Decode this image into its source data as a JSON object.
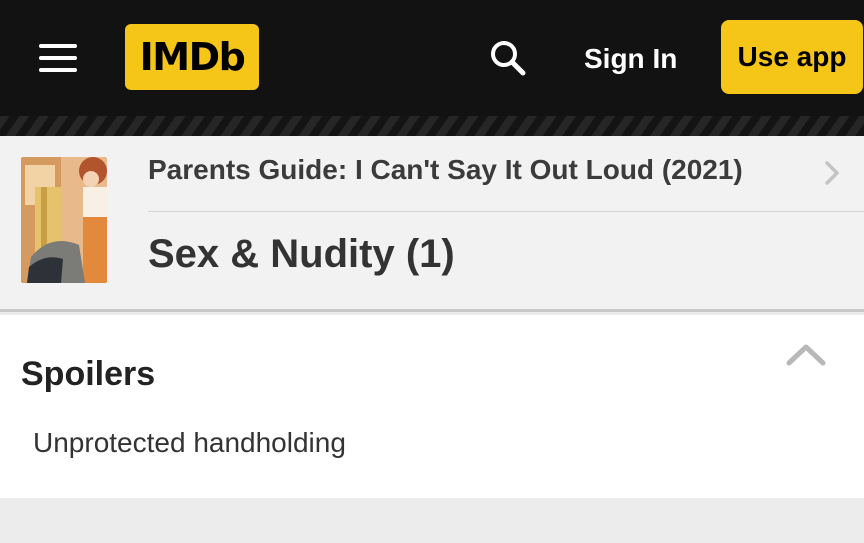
{
  "header": {
    "logo_text": "IMDb",
    "sign_in_label": "Sign In",
    "use_app_label": "Use app",
    "colors": {
      "bar": "#121212",
      "accent": "#f5c518"
    },
    "icons": [
      "menu-icon",
      "search-icon"
    ]
  },
  "title_card": {
    "breadcrumb": "Parents Guide: I Can't Say It Out Loud (2021)",
    "section_title": "Sex & Nudity (1)",
    "icons": [
      "poster-thumbnail",
      "chevron-right-icon"
    ]
  },
  "content": {
    "heading": "Spoilers",
    "items": [
      "Unprotected handholding"
    ],
    "icons": [
      "chevron-up-icon"
    ]
  }
}
